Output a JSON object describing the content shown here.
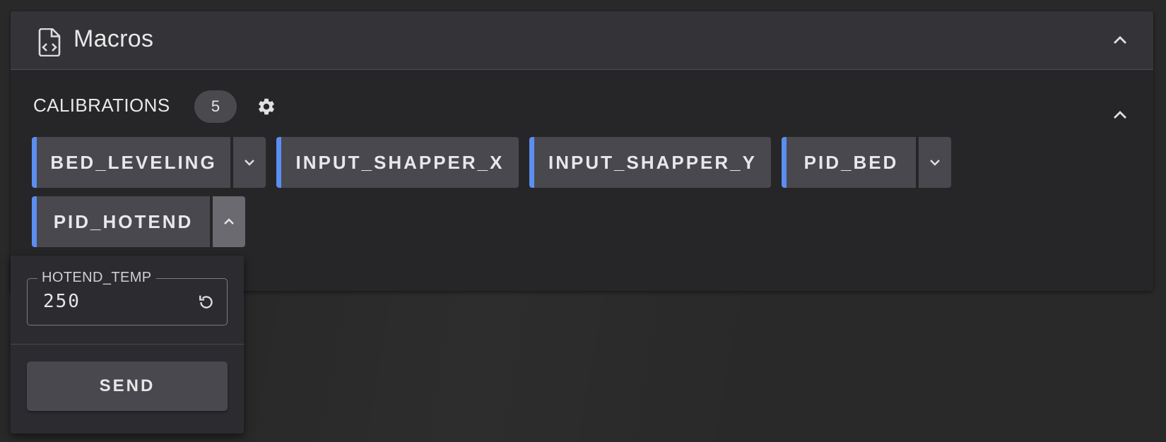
{
  "panel": {
    "title": "Macros",
    "icon": "file-code-icon",
    "collapse_icon": "chevron-up-icon"
  },
  "section": {
    "title": "CALIBRATIONS",
    "count": "5",
    "settings_icon": "gear-icon",
    "collapse_icon": "chevron-up-icon"
  },
  "macros": [
    {
      "label": "BED_LEVELING",
      "has_params": true,
      "expanded": false
    },
    {
      "label": "INPUT_SHAPPER_X",
      "has_params": false
    },
    {
      "label": "INPUT_SHAPPER_Y",
      "has_params": false
    },
    {
      "label": "PID_BED",
      "has_params": true,
      "expanded": false
    },
    {
      "label": "PID_HOTEND",
      "has_params": true,
      "expanded": true
    }
  ],
  "popup": {
    "param_label": "HOTEND_TEMP",
    "param_value": "250",
    "reset_icon": "reset-icon",
    "send_label": "SEND"
  },
  "colors": {
    "accent": "#5b8ef0",
    "background": "#292929",
    "card": "#262628",
    "header": "#333338",
    "button": "#48484e"
  }
}
